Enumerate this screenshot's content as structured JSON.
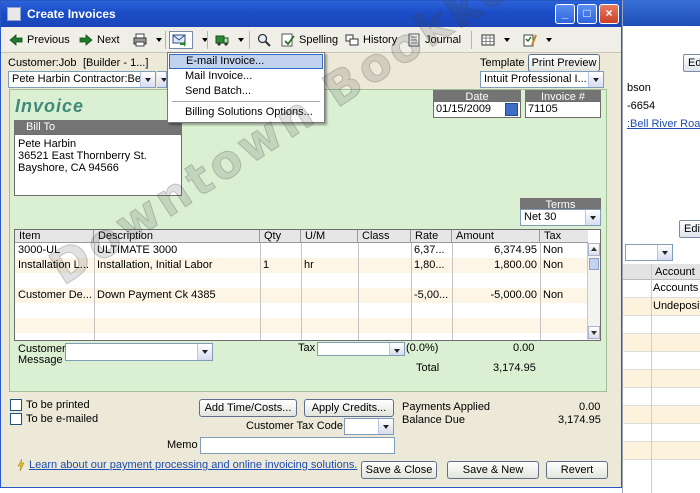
{
  "window": {
    "title": "Create Invoices"
  },
  "toolbar": {
    "previous": "Previous",
    "next": "Next",
    "spelling": "Spelling",
    "history": "History",
    "journal": "Journal"
  },
  "send_menu": {
    "items": [
      "E-mail Invoice...",
      "Mail Invoice...",
      "Send Batch...",
      "Billing Solutions Options..."
    ]
  },
  "header": {
    "customer_job_label": "Customer:Job",
    "class_label": "[Builder - 1...]",
    "customer_job_value": "Pete Harbin Contractor:Bell",
    "template_label": "Template",
    "print_preview": "Print Preview",
    "template_value": "Intuit Professional I..."
  },
  "invoice": {
    "heading": "Invoice",
    "date_label": "Date",
    "date_value": "01/15/2009",
    "number_label": "Invoice #",
    "number_value": "71105",
    "bill_to_label": "Bill To",
    "bill_to_lines": [
      "Pete Harbin",
      "36521 East Thornberry St.",
      "Bayshore, CA 94566"
    ],
    "terms_label": "Terms",
    "terms_value": "Net 30"
  },
  "grid": {
    "columns": [
      "Item",
      "Description",
      "Qty",
      "U/M",
      "Class",
      "Rate",
      "Amount",
      "Tax"
    ],
    "rows": [
      {
        "item": "3000-UL",
        "description": "ULTIMATE 3000",
        "qty": "",
        "um": "",
        "class": "",
        "rate": "6,37...",
        "amount": "6,374.95",
        "tax": "Non"
      },
      {
        "item": "Installation L...",
        "description": "Installation, Initial Labor",
        "qty": "1",
        "um": "hr",
        "class": "",
        "rate": "1,80...",
        "amount": "1,800.00",
        "tax": "Non"
      },
      {
        "item": "",
        "description": "",
        "qty": "",
        "um": "",
        "class": "",
        "rate": "",
        "amount": "",
        "tax": ""
      },
      {
        "item": "Customer De...",
        "description": "Down Payment Ck 4385",
        "qty": "",
        "um": "",
        "class": "",
        "rate": "-5,00...",
        "amount": "-5,000.00",
        "tax": "Non"
      }
    ]
  },
  "footer": {
    "customer_message_label_1": "Customer",
    "customer_message_label_2": "Message",
    "tax_label": "Tax",
    "tax_rate": "(0.0%)",
    "tax_amount": "0.00",
    "total_label": "Total",
    "total_amount": "3,174.95",
    "to_be_printed": "To be printed",
    "to_be_emailed": "To be e-mailed",
    "add_time_costs": "Add Time/Costs...",
    "apply_credits": "Apply Credits...",
    "payments_applied_label": "Payments Applied",
    "payments_applied_value": "0.00",
    "balance_due_label": "Balance Due",
    "balance_due_value": "3,174.95",
    "customer_tax_code_label": "Customer Tax Code",
    "memo_label": "Memo",
    "learn_link": "Learn about our payment processing and online invoicing solutions.",
    "save_close": "Save & Close",
    "save_new": "Save & New",
    "revert": "Revert"
  },
  "background_window": {
    "button_top": "Ed",
    "text_1": "bson",
    "text_2": "-6654",
    "link_1": ":Bell River Road",
    "button_mid": "Edi",
    "col_account": "Account",
    "row_1": "Accounts Re",
    "row_2": "Undeposited"
  },
  "watermark": {
    "text": "Downtown Bookkeeping"
  },
  "colors": {
    "title_blue": "#1b4dc7",
    "panel_green": "#dbf0d2",
    "invoice_teal": "#3f8a7a",
    "window_face": "#ece9d8",
    "link_blue": "#1d4cb3"
  }
}
